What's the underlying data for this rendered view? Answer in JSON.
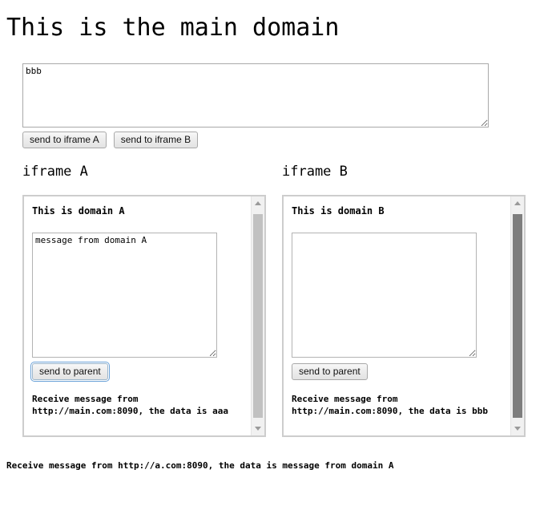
{
  "main": {
    "title": "This is the main domain",
    "textarea": {
      "value": "bbb",
      "placeholder": ""
    },
    "buttons": {
      "send_to_a": "send to iframe A",
      "send_to_b": "send to iframe B"
    },
    "bottom_message": "Receive message from http://a.com:8090, the data is message from domain A"
  },
  "frames": [
    {
      "heading": "iframe A",
      "domain_title": "This is domain A",
      "textarea": {
        "value": "message from domain A",
        "placeholder": ""
      },
      "button_label": "send to parent",
      "button_focused": true,
      "receive_message": "Receive message from\nhttp://main.com:8090, the data is aaa",
      "scrollbar": {
        "up_icon": "triangle-up-icon",
        "down_icon": "triangle-down-icon",
        "thumb_state": "light"
      }
    },
    {
      "heading": "iframe B",
      "domain_title": "This is domain B",
      "textarea": {
        "value": "",
        "placeholder": ""
      },
      "button_label": "send to parent",
      "button_focused": false,
      "receive_message": "Receive message from\nhttp://main.com:8090, the data is bbb",
      "scrollbar": {
        "up_icon": "triangle-up-icon",
        "down_icon": "triangle-down-icon",
        "thumb_state": "dark"
      }
    }
  ],
  "colors": {
    "page_background": "#ffffff",
    "text": "#000000",
    "iframe_border": "#cdcdcd",
    "textarea_border": "#a9a9a9",
    "button_border": "#a8a8a8",
    "focus_ring": "#6ca2d8",
    "scrollbar_track": "#f1f1f1",
    "scrollbar_thumb_light": "#c1c1c1",
    "scrollbar_thumb_dark": "#7e7e7e"
  }
}
